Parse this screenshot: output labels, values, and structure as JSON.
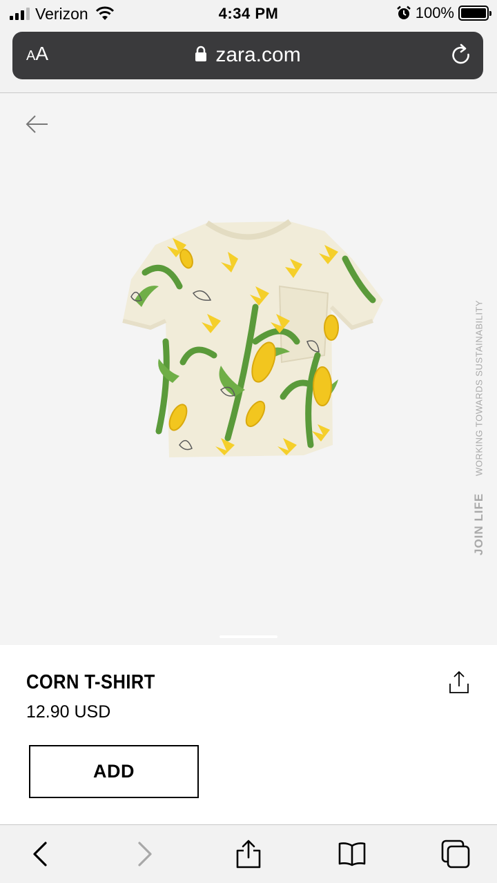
{
  "status_bar": {
    "carrier": "Verizon",
    "time": "4:34 PM",
    "battery_percent": "100%",
    "signal_bars": 3,
    "signal_bars_total": 4
  },
  "browser": {
    "text_size_label_small": "A",
    "text_size_label_large": "A",
    "url": "zara.com"
  },
  "product": {
    "name": "CORN T-SHIRT",
    "price": "12.90 USD",
    "add_label": "ADD"
  },
  "sustainability": {
    "title": "JOIN LIFE",
    "subtitle": "WORKING TOWARDS SUSTAINABILITY",
    "color": "#a9a9a9"
  },
  "icons": {
    "back": "arrow-left-icon",
    "share": "share-icon",
    "lock": "lock-icon",
    "reload": "reload-icon",
    "bookmarks": "book-icon",
    "tabs": "tabs-icon"
  },
  "colors": {
    "url_bar": "#3a3a3c",
    "accent": "#000000",
    "shirt_base": "#f1ecd9",
    "leaf_green": "#5a9a3a",
    "corn_yellow": "#f2c61f"
  }
}
